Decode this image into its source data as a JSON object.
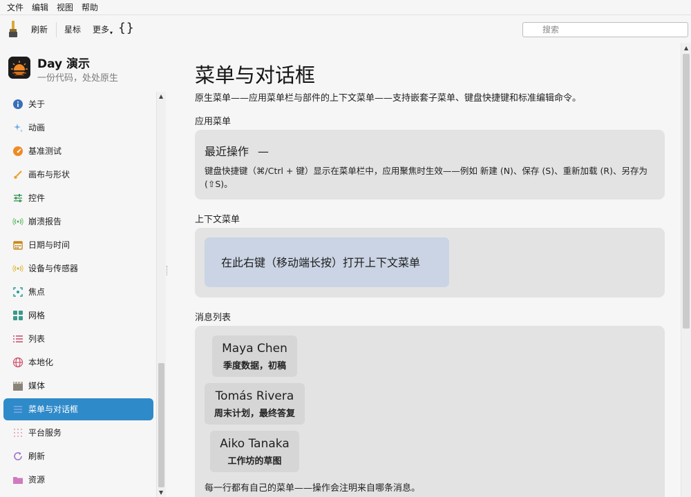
{
  "menubar": {
    "items": [
      "文件",
      "编辑",
      "视图",
      "帮助"
    ]
  },
  "toolbar": {
    "refresh_label": "刷新",
    "star_label": "星标",
    "more_label": "更多",
    "braces_label": "{}",
    "search_placeholder": "搜索"
  },
  "sidebar": {
    "app_title": "Day 演示",
    "app_subtitle": "一份代码，处处原生",
    "items": [
      {
        "label": "关于",
        "icon": "info-icon"
      },
      {
        "label": "动画",
        "icon": "sparkle-icon"
      },
      {
        "label": "基准测试",
        "icon": "gauge-icon"
      },
      {
        "label": "画布与形状",
        "icon": "brush-icon"
      },
      {
        "label": "控件",
        "icon": "sliders-icon"
      },
      {
        "label": "崩溃报告",
        "icon": "broadcast-icon"
      },
      {
        "label": "日期与时间",
        "icon": "calendar-icon"
      },
      {
        "label": "设备与传感器",
        "icon": "sensor-icon"
      },
      {
        "label": "焦点",
        "icon": "focus-icon"
      },
      {
        "label": "网格",
        "icon": "grid-icon"
      },
      {
        "label": "列表",
        "icon": "list-icon"
      },
      {
        "label": "本地化",
        "icon": "globe-icon"
      },
      {
        "label": "媒体",
        "icon": "clapper-icon"
      },
      {
        "label": "菜单与对话框",
        "icon": "menu-icon",
        "active": true
      },
      {
        "label": "平台服务",
        "icon": "dots-grid-icon"
      },
      {
        "label": "刷新",
        "icon": "refresh-icon"
      },
      {
        "label": "资源",
        "icon": "folder-icon"
      }
    ]
  },
  "main": {
    "title": "菜单与对话框",
    "description": "原生菜单——应用菜单栏与部件的上下文菜单——支持嵌套子菜单、键盘快捷键和标准编辑命令。",
    "app_menu": {
      "label": "应用菜单",
      "recent_title": "最近操作",
      "recent_value": "—",
      "body": "键盘快捷键（⌘/Ctrl + 键）显示在菜单栏中，应用聚焦时生效——例如 新建 (N)、保存 (S)、重新加载 (R)、另存为 (⇧S)。"
    },
    "context_menu": {
      "label": "上下文菜单",
      "target_text": "在此右键（移动端长按）打开上下文菜单"
    },
    "message_list": {
      "label": "消息列表",
      "messages": [
        {
          "name": "Maya Chen",
          "subject": "季度数据，初稿"
        },
        {
          "name": "Tomás Rivera",
          "subject": "周末计划，最终答复"
        },
        {
          "name": "Aiko Tanaka",
          "subject": "工作坊的草图"
        }
      ],
      "note": "每一行都有自己的菜单——操作会注明来自哪条消息。"
    }
  },
  "colors": {
    "accent": "#2f8ac9",
    "card_bg": "#e3e3e3",
    "context_target_bg": "#cad4e4"
  }
}
